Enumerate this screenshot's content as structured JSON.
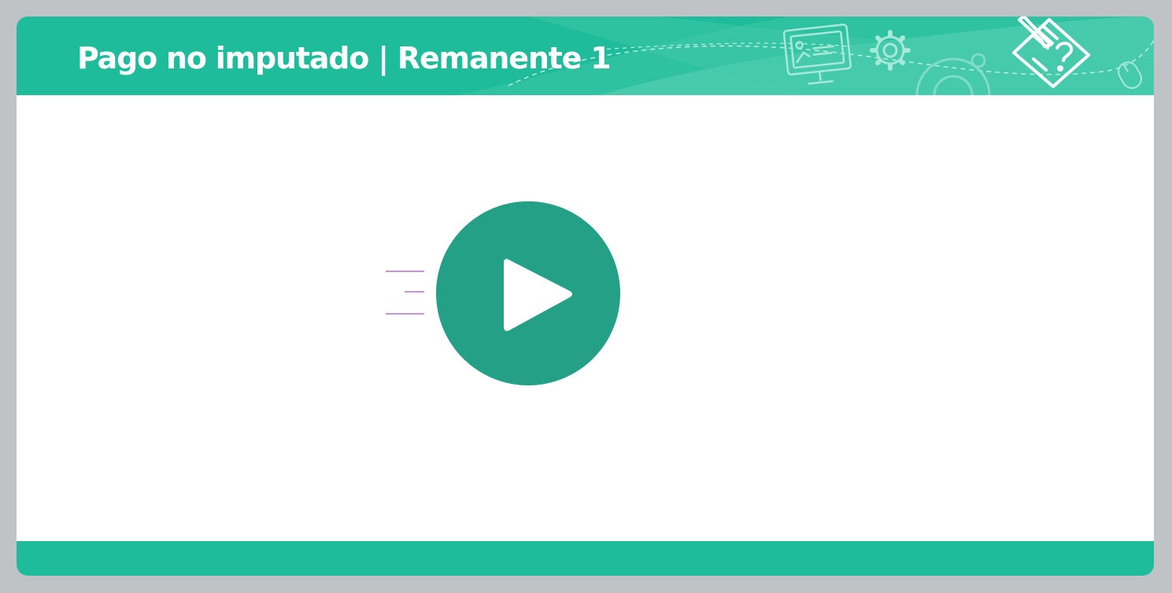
{
  "header": {
    "title": "Pago no imputado | Remanente 1"
  },
  "video": {
    "play_button_label": "Play"
  },
  "colors": {
    "background": "#bfc3c6",
    "accent": "#1ebc9a",
    "play_circle": "#23a086",
    "speed_lines": "#9b59b6"
  },
  "icons": {
    "header_decorations": [
      "presentation-screen-icon",
      "gear-icon",
      "large-gear-icon",
      "mouse-icon",
      "checklist-pencil-icon"
    ],
    "player": [
      "play-icon"
    ]
  }
}
